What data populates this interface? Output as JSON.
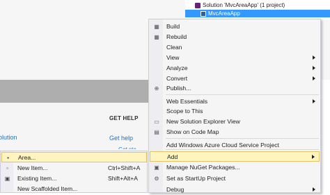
{
  "solution_explorer": {
    "solution_label": "Solution 'MvcAreaApp' (1 project)",
    "project_label": "MvcAreaApp"
  },
  "start_page": {
    "get_help_heading": "GET HELP",
    "get_help_link": "Get help",
    "get_help_link2": "Get sta...",
    "solution_link": "olution"
  },
  "context_menu": {
    "items": [
      {
        "label": "Build",
        "icon": "build-icon",
        "glyph": "▦"
      },
      {
        "label": "Rebuild",
        "icon": "rebuild-icon",
        "glyph": "▦"
      },
      {
        "label": "Clean",
        "icon": "",
        "glyph": ""
      },
      {
        "label": "View",
        "icon": "",
        "glyph": "",
        "submenu": true
      },
      {
        "label": "Analyze",
        "icon": "",
        "glyph": "",
        "submenu": true
      },
      {
        "label": "Convert",
        "icon": "",
        "glyph": "",
        "submenu": true
      },
      {
        "label": "Publish...",
        "icon": "globe-icon",
        "glyph": "⊕"
      },
      {
        "label": "Web Essentials",
        "icon": "",
        "glyph": "",
        "submenu": true
      },
      {
        "label": "Scope to This",
        "icon": "",
        "glyph": ""
      },
      {
        "label": "New Solution Explorer View",
        "icon": "new-window-icon",
        "glyph": "▭"
      },
      {
        "label": "Show on Code Map",
        "icon": "code-map-icon",
        "glyph": "▤"
      },
      {
        "label": "Add Windows Azure Cloud Service Project",
        "icon": "",
        "glyph": ""
      },
      {
        "label": "Add",
        "icon": "",
        "glyph": "",
        "submenu": true,
        "hover": true
      },
      {
        "label": "Manage NuGet Packages...",
        "icon": "nuget-icon",
        "glyph": "▣"
      },
      {
        "label": "Set as StartUp Project",
        "icon": "gear-icon",
        "glyph": "⚙"
      },
      {
        "label": "Debug",
        "icon": "",
        "glyph": "",
        "submenu": true
      }
    ]
  },
  "add_submenu": {
    "items": [
      {
        "label": "Area...",
        "shortcut": "",
        "icon": "area-icon",
        "glyph": "▪",
        "hover": true
      },
      {
        "label": "New Item...",
        "shortcut": "Ctrl+Shift+A",
        "icon": "new-item-icon",
        "glyph": "▫"
      },
      {
        "label": "Existing Item...",
        "shortcut": "Shift+Alt+A",
        "icon": "existing-item-icon",
        "glyph": "▣"
      },
      {
        "label": "New Scaffolded Item...",
        "shortcut": "",
        "icon": "",
        "glyph": ""
      }
    ]
  },
  "colors": {
    "selection_blue": "#3399ff",
    "menu_hover_fill": "#fdf4bf",
    "menu_hover_border": "#e5c365",
    "link_blue": "#1e73be"
  }
}
